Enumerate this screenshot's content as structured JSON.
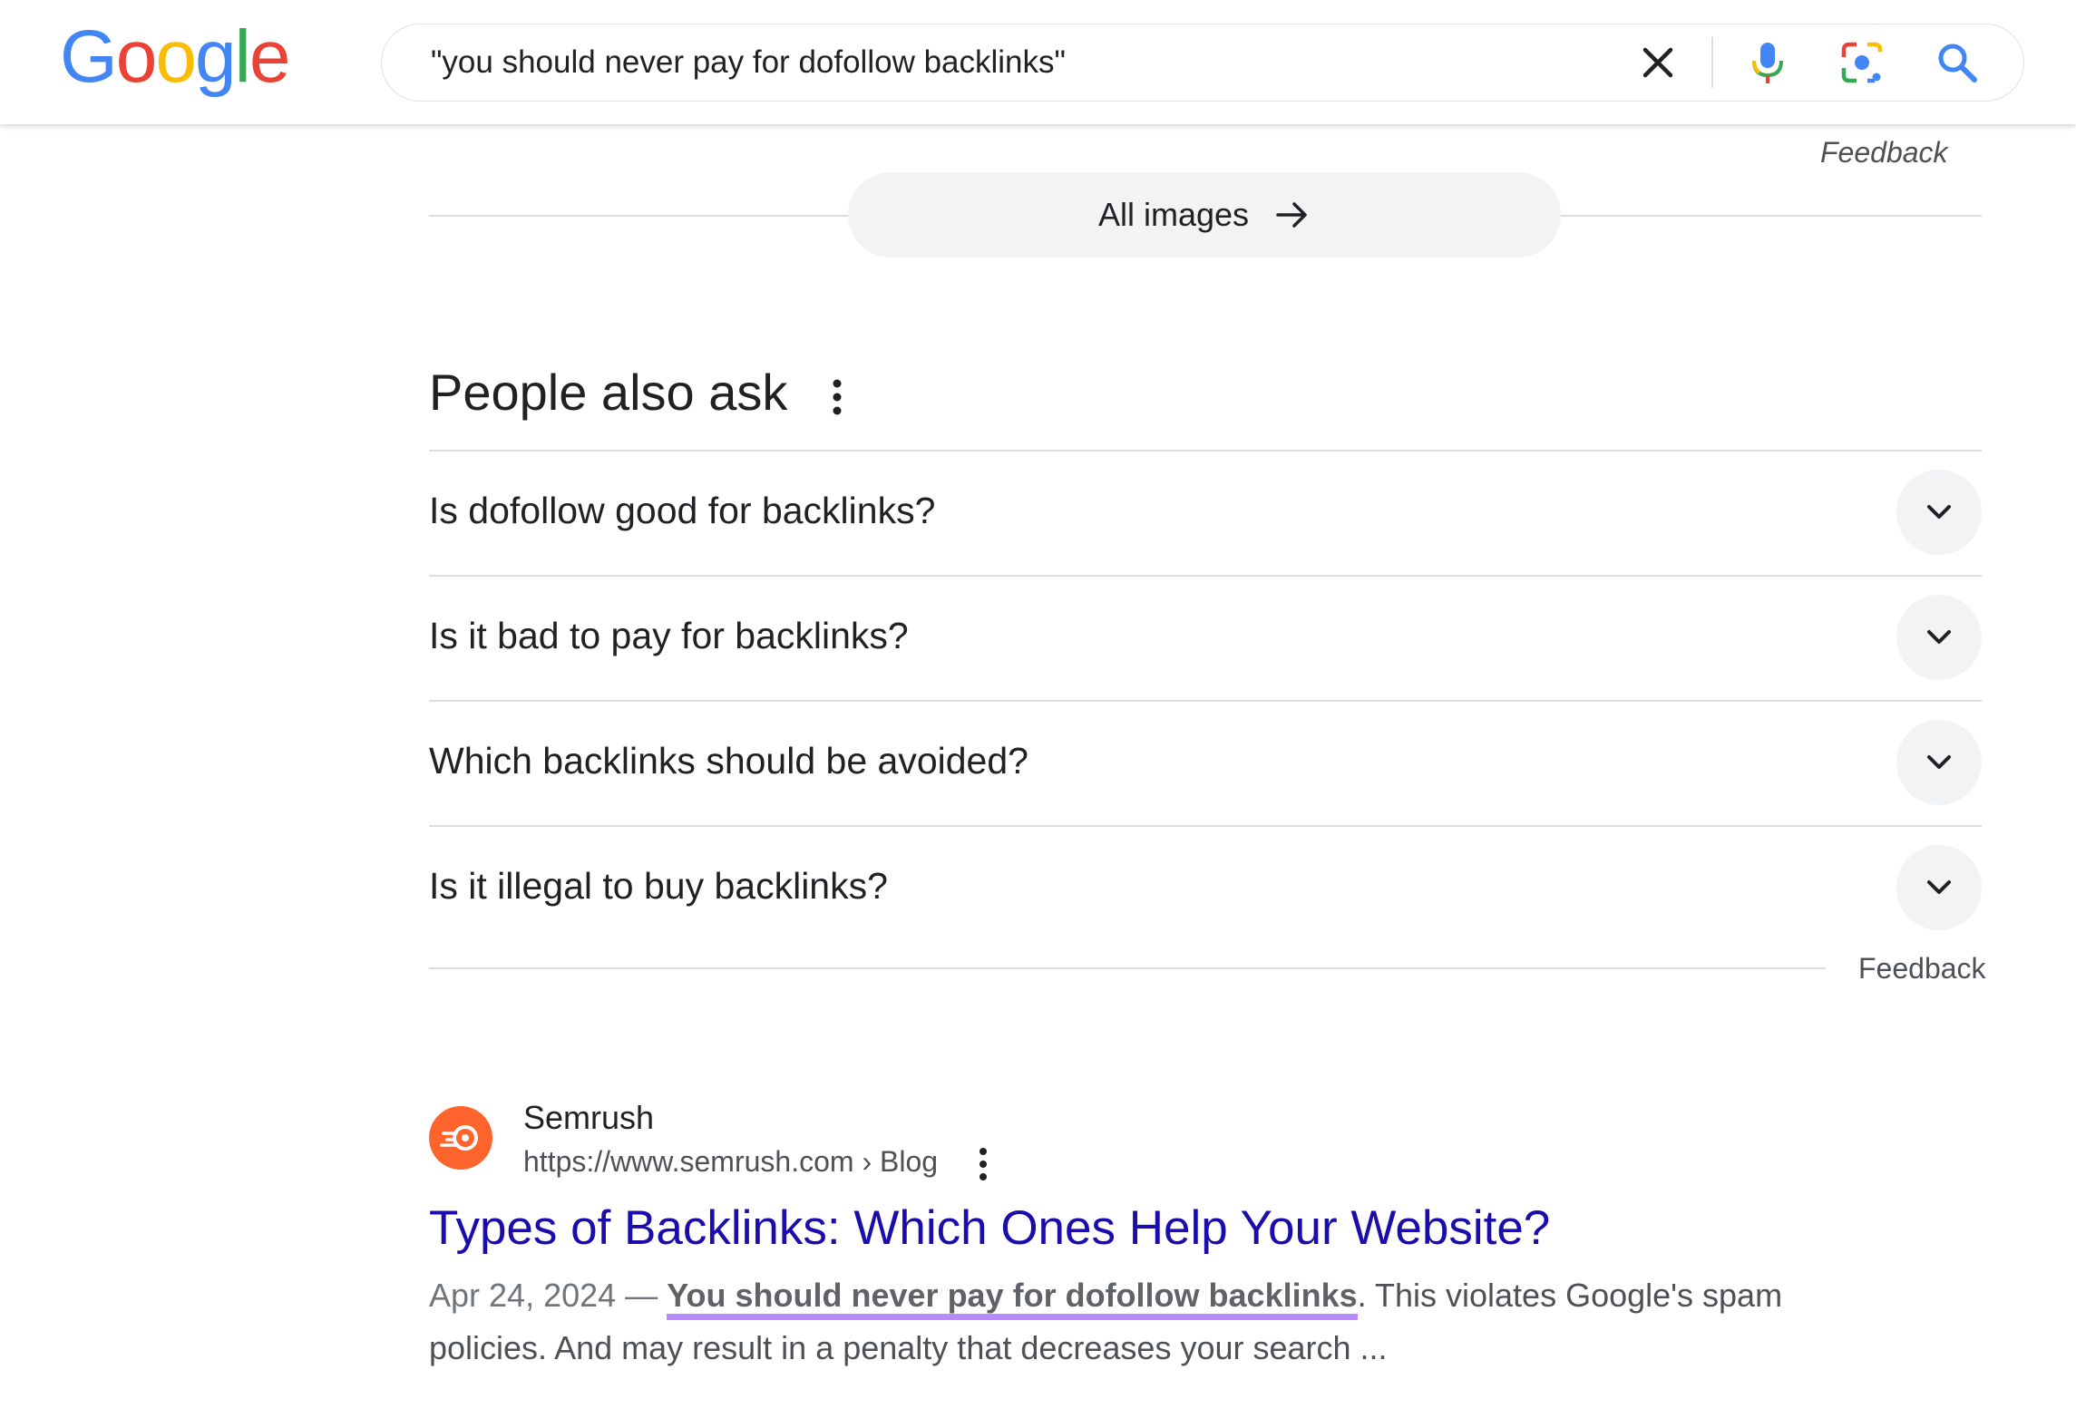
{
  "header": {
    "logo": {
      "letters": [
        "G",
        "o",
        "o",
        "g",
        "l",
        "e"
      ],
      "colors": [
        "#4285F4",
        "#EA4335",
        "#FBBC05",
        "#4285F4",
        "#34A853",
        "#EA4335"
      ]
    },
    "search": {
      "query": "\"you should never pay for dofollow backlinks\""
    }
  },
  "images_section": {
    "feedback": "Feedback",
    "all_images": "All images"
  },
  "people_also_ask": {
    "title": "People also ask",
    "questions": [
      "Is dofollow good for backlinks?",
      "Is it bad to pay for backlinks?",
      "Which backlinks should be avoided?",
      "Is it illegal to buy backlinks?"
    ],
    "feedback": "Feedback"
  },
  "result": {
    "site_name": "Semrush",
    "url": "https://www.semrush.com › Blog",
    "title": "Types of Backlinks: Which Ones Help Your Website?",
    "date": "Apr 24, 2024 —",
    "highlight": "You should never pay for dofollow backlinks",
    "snippet_rest": ". This violates Google's spam policies. And may result in a penalty that decreases your search ...",
    "accent_color": "#ff642d",
    "highlight_color": "#b98aff"
  }
}
